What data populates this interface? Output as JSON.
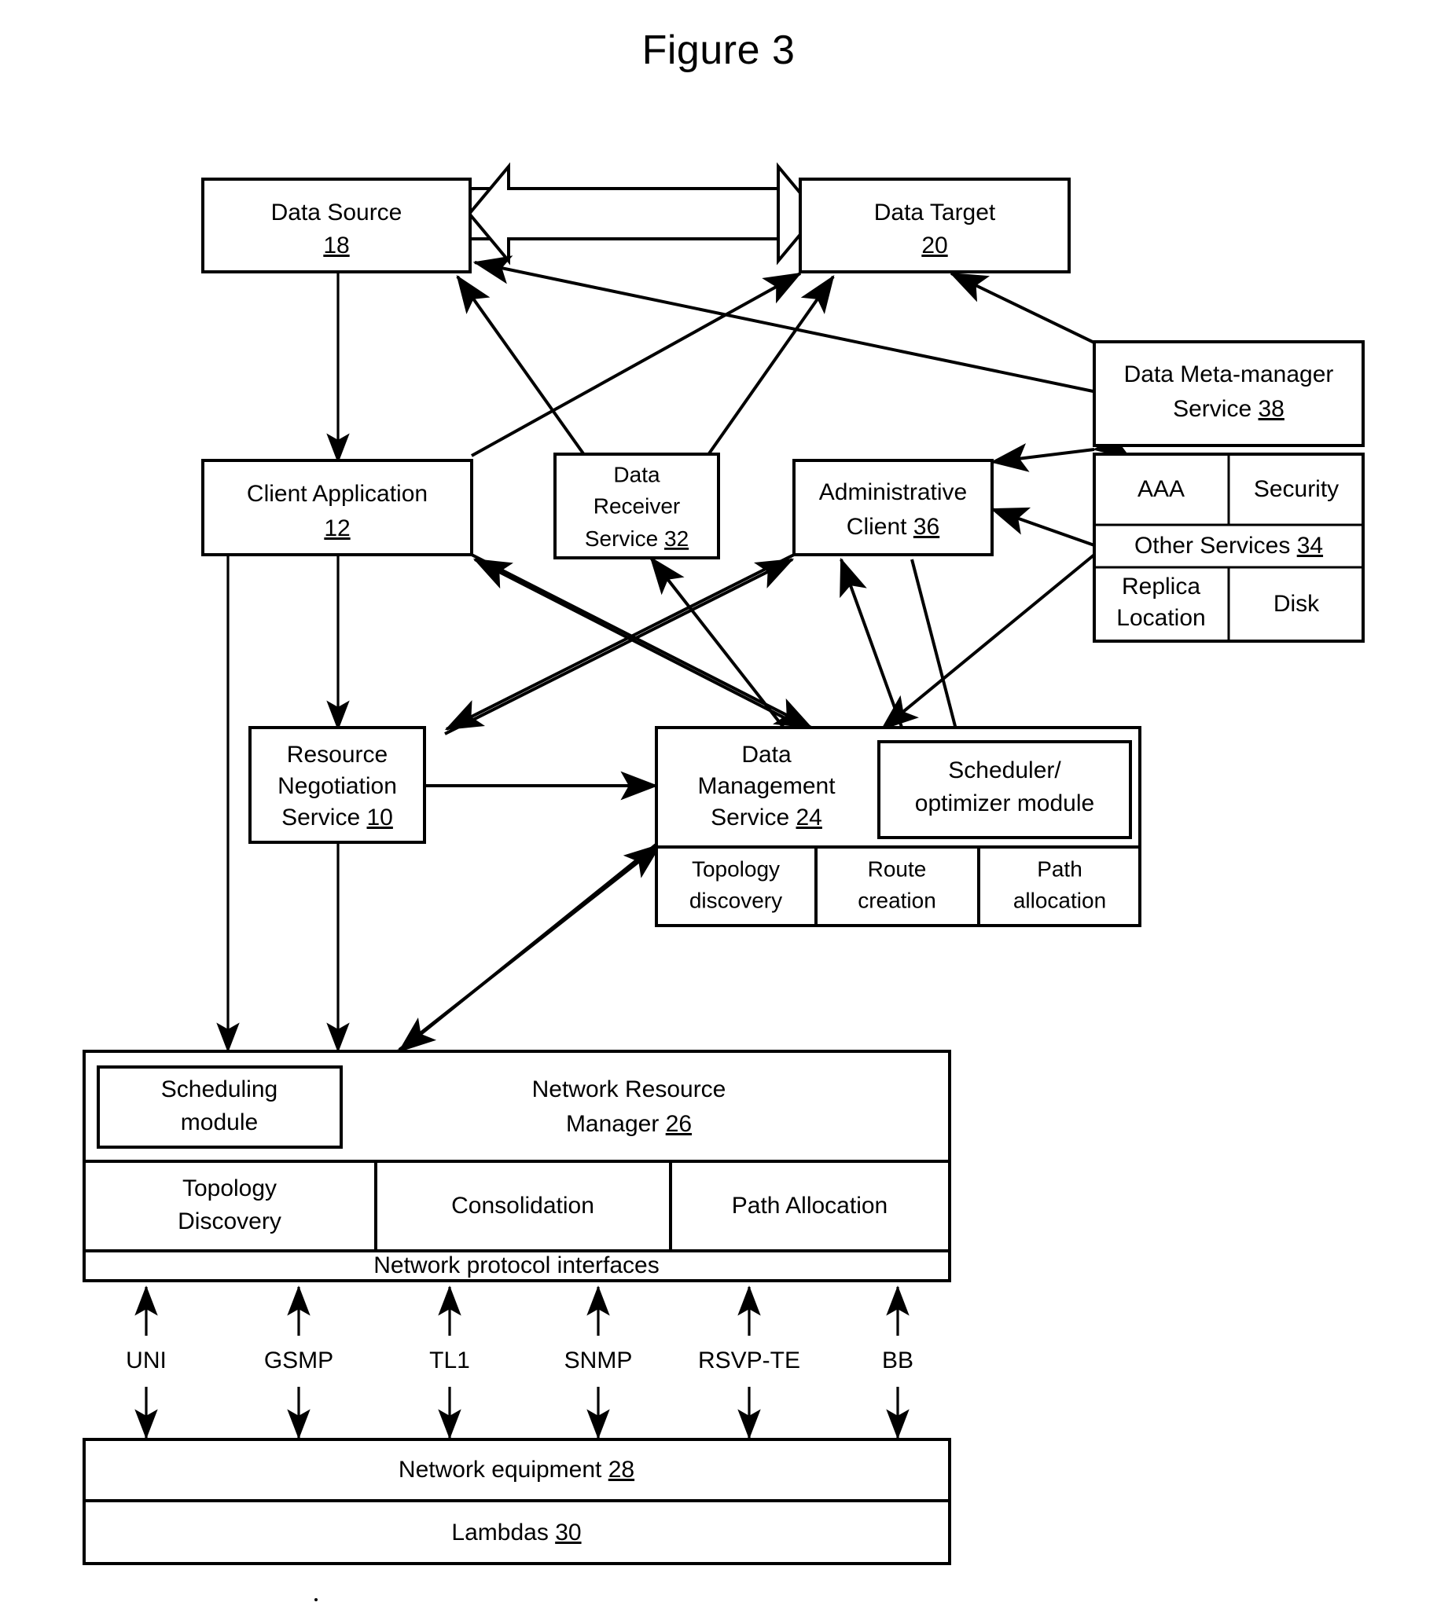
{
  "figure": {
    "title": "Figure 3"
  },
  "nodes": {
    "data_source": {
      "line1": "Data Source",
      "ref": "18"
    },
    "data_target": {
      "line1": "Data Target",
      "ref": "20"
    },
    "data_meta_manager": {
      "line1": "Data Meta-manager",
      "line2": "Service",
      "ref": "38"
    },
    "client_application": {
      "line1": "Client Application",
      "ref": "12"
    },
    "data_receiver": {
      "line1": "Data",
      "line2": "Receiver",
      "line3": "Service",
      "ref": "32"
    },
    "administrative_client": {
      "line1": "Administrative",
      "line2": "Client",
      "ref": "36"
    },
    "other_services": {
      "aaa": "AAA",
      "security": "Security",
      "title": "Other Services",
      "ref": "34",
      "replica_line1": "Replica",
      "replica_line2": "Location",
      "disk": "Disk"
    },
    "resource_negotiation": {
      "line1": "Resource",
      "line2": "Negotiation",
      "line3": "Service",
      "ref": "10"
    },
    "data_management": {
      "line1": "Data",
      "line2": "Management",
      "line3": "Service",
      "ref": "24",
      "scheduler_line1": "Scheduler/",
      "scheduler_line2": "optimizer module",
      "sub": [
        {
          "line1": "Topology",
          "line2": "discovery"
        },
        {
          "line1": "Route",
          "line2": "creation"
        },
        {
          "line1": "Path",
          "line2": "allocation"
        }
      ]
    },
    "network_resource_manager": {
      "line1": "Network Resource",
      "line2": "Manager",
      "ref": "26",
      "scheduling_line1": "Scheduling",
      "scheduling_line2": "module",
      "sub": [
        {
          "line1": "Topology",
          "line2": "Discovery"
        },
        {
          "line1": "Consolidation",
          "line2": ""
        },
        {
          "line1": "Path Allocation",
          "line2": ""
        }
      ],
      "interfaces": "Network protocol interfaces"
    },
    "network_equipment": {
      "line1": "Network equipment",
      "ref": "28"
    },
    "lambdas": {
      "line1": "Lambdas",
      "ref": "30"
    }
  },
  "protocols": [
    "UNI",
    "GSMP",
    "TL1",
    "SNMP",
    "RSVP-TE",
    "BB"
  ],
  "colors": {
    "stroke": "#000000",
    "fill": "#ffffff",
    "background": "#ffffff"
  },
  "chart_data": {
    "type": "diagram",
    "title": "Figure 3",
    "nodes": [
      "Data Source 18",
      "Data Target 20",
      "Data Meta-manager Service 38",
      "Client Application 12",
      "Data Receiver Service 32",
      "Administrative Client 36",
      "Other Services 34 (AAA, Security, Replica Location, Disk)",
      "Resource Negotiation Service 10",
      "Data Management Service 24 (Scheduler/optimizer module; Topology discovery, Route creation, Path allocation)",
      "Network Resource Manager 26 (Scheduling module; Topology Discovery, Consolidation, Path Allocation; Network protocol interfaces)",
      "Network equipment 28",
      "Lambdas 30"
    ],
    "edges": [
      "Data Source 18 <-> Data Target 20",
      "Data Source 18 <-> Client Application 12",
      "Data Source 18 <- Data Receiver Service 32",
      "Data Source 18 <- Data Meta-manager Service 38",
      "Data Target 20 <- Client Application 12",
      "Data Target 20 <- Data Receiver Service 32",
      "Data Target 20 <- Data Meta-manager Service 38",
      "Data Meta-manager Service 38 <-> Administrative Client 36",
      "Data Meta-manager Service 38 <-> Other Services 34",
      "Client Application 12 <-> Resource Negotiation Service 10",
      "Client Application 12 -> Data Management Service 24",
      "Client Application 12 <- Data Management Service 24",
      "Data Receiver Service 32 <- Data Management Service 24",
      "Administrative Client 36 <-> Data Management Service 24",
      "Administrative Client 36 <-> Other Services 34",
      "Administrative Client 36 <- Resource Negotiation Service 10",
      "Resource Negotiation Service 10 <-> Data Management Service 24",
      "Resource Negotiation Service 10 <-> Network Resource Manager 26",
      "Client Application 12 <-> Network Resource Manager 26",
      "Data Management Service 24 <-> Network Resource Manager 26",
      "Network protocol interfaces <-> Network equipment 28 via UNI, GSMP, TL1, SNMP, RSVP-TE, BB",
      "Network equipment 28 / Lambdas 30"
    ]
  }
}
